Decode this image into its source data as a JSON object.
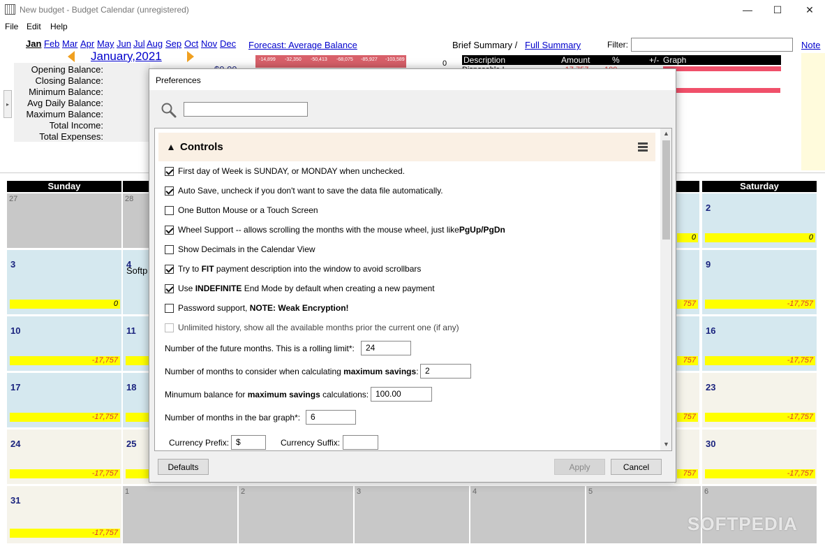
{
  "window": {
    "title": "New budget - Budget Calendar (unregistered)"
  },
  "menu": [
    "File",
    "Edit",
    "Help"
  ],
  "months": [
    "Jan",
    "Feb",
    "Mar",
    "Apr",
    "May",
    "Jun",
    "Jul",
    "Aug",
    "Sep",
    "Oct",
    "Nov",
    "Dec"
  ],
  "current_month": "January,2021",
  "summary": {
    "labels": [
      "Opening Balance:",
      "Closing Balance:",
      "Minimum Balance:",
      "Avg Daily Balance:",
      "Maximum Balance:",
      "Total Income:",
      "Total Expenses:"
    ],
    "opening_value_partial": "$0.00"
  },
  "forecast_link": "Forecast: Average Balance",
  "forecast_values": [
    "-14,899",
    "-32,350",
    "-50,413",
    "-68,075",
    "-85,927",
    "-103,589"
  ],
  "forecast_zero": "0",
  "brief_summary": "Brief Summary /",
  "full_summary_link": "Full Summary",
  "filter_label": "Filter:",
  "filter_value": "",
  "note_link": "Note",
  "summary_table": {
    "headers": [
      "Description",
      "Amount",
      "%",
      "+/-",
      "Graph"
    ],
    "row_partial": "Disposable I...",
    "amount_partial": "-17,757",
    "pct_partial": "100"
  },
  "calendar": {
    "days": [
      "Sunday",
      "Saturday"
    ],
    "cells": [
      {
        "day": "27",
        "type": "gray"
      },
      {
        "day": "28",
        "type": "gray"
      },
      {
        "day": "2",
        "type": "blue",
        "balance": "0"
      },
      {
        "day": "3",
        "type": "blue",
        "balance": "0"
      },
      {
        "day": "4",
        "type": "blue",
        "partial": "Softp"
      },
      {
        "day": "9",
        "type": "blue",
        "balance": "-17,757"
      },
      {
        "day": "10",
        "type": "blue",
        "balance": "-17,757"
      },
      {
        "day": "11",
        "type": "blue"
      },
      {
        "day": "16",
        "type": "blue",
        "balance": "-17,757"
      },
      {
        "day": "17",
        "type": "blue",
        "balance": "-17,757"
      },
      {
        "day": "18",
        "type": "blue"
      },
      {
        "day": "23",
        "type": "cream",
        "balance": "-17,757"
      },
      {
        "day": "24",
        "type": "cream",
        "balance": "-17,757"
      },
      {
        "day": "25",
        "type": "cream"
      },
      {
        "day": "30",
        "type": "cream",
        "balance": "-17,757"
      },
      {
        "day": "31",
        "type": "cream",
        "balance": "-17,757"
      },
      {
        "day": "1",
        "type": "gray"
      },
      {
        "day": "2",
        "type": "gray"
      },
      {
        "day": "3",
        "type": "gray"
      },
      {
        "day": "4",
        "type": "gray"
      },
      {
        "day": "5",
        "type": "gray"
      },
      {
        "day": "6",
        "type": "gray"
      }
    ],
    "partial_balances": {
      "row1": "0",
      "row2": "757",
      "row3": "757",
      "row4": "757",
      "row5": "757"
    }
  },
  "dialog": {
    "title": "Preferences",
    "search_value": "",
    "section_title": "Controls",
    "options": [
      {
        "checked": true,
        "label": "First day of Week is SUNDAY, or MONDAY when unchecked."
      },
      {
        "checked": true,
        "label": "Auto Save, uncheck if you don't want to save the data file automatically."
      },
      {
        "checked": false,
        "label": "One Button Mouse or a Touch Screen"
      },
      {
        "checked": true,
        "label": "Wheel Support -- allows scrolling the months with the mouse wheel, just like ",
        "bold": "PgUp/PgDn"
      },
      {
        "checked": false,
        "label": "Show Decimals in the Calendar View"
      },
      {
        "checked": true,
        "pre": "Try to ",
        "bold": "FIT",
        "post": " payment description into the window to avoid scrollbars"
      },
      {
        "checked": true,
        "pre": "Use ",
        "bold": "INDEFINITE",
        "post": " End Mode by default when creating a new payment"
      },
      {
        "checked": false,
        "pre": "Password support, ",
        "bold": "NOTE: Weak Encryption!",
        "post": ""
      },
      {
        "checked": false,
        "disabled": true,
        "label": "Unlimited history, show all the available months prior the current one (if any)"
      }
    ],
    "fields": {
      "future_months": {
        "label": "Number of the future months. This is a rolling limit*:",
        "value": "24"
      },
      "max_savings_months": {
        "pre": "Number of months to consider when calculating ",
        "bold": "maximum savings",
        "post": ":",
        "value": "2"
      },
      "min_balance": {
        "pre": "Minumum balance for ",
        "bold": "maximum savings",
        "post": " calculations:",
        "value": "100.00"
      },
      "bar_graph_months": {
        "label": "Number of months in the bar graph*:",
        "value": "6"
      },
      "currency_prefix": {
        "label": "Currency Prefix:",
        "value": "$"
      },
      "currency_suffix": {
        "label": "Currency Suffix:",
        "value": ""
      }
    },
    "buttons": {
      "defaults": "Defaults",
      "apply": "Apply",
      "cancel": "Cancel"
    }
  },
  "watermark": "SOFTPEDIA",
  "colors": {
    "link": "#0000cc",
    "balance_bar": "#ffff00",
    "negative": "#dd3333",
    "day_blue": "#d5e8ef",
    "day_gray": "#c8c8c8",
    "day_cream": "#f5f3ea"
  }
}
